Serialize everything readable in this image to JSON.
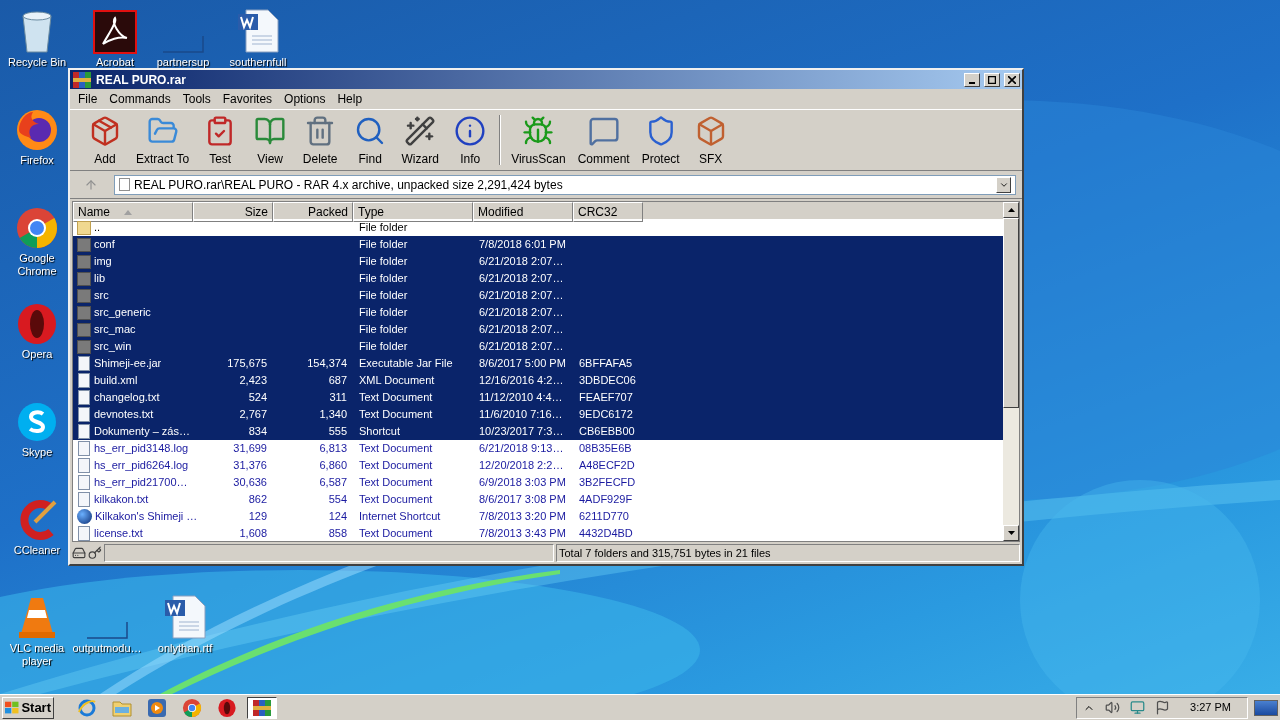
{
  "desktop_icons": [
    {
      "label": "Recycle Bin",
      "kind": "recycle"
    },
    {
      "label": "Acrobat",
      "kind": "acrobat"
    },
    {
      "label": "partnersup",
      "kind": "blank"
    },
    {
      "label": "southernfull",
      "kind": "word"
    },
    {
      "label": "Firefox",
      "kind": "firefox"
    },
    {
      "label": "Google Chrome",
      "kind": "chrome"
    },
    {
      "label": "Opera",
      "kind": "opera"
    },
    {
      "label": "Skype",
      "kind": "skype"
    },
    {
      "label": "CCleaner",
      "kind": "ccleaner"
    },
    {
      "label": "VLC media player",
      "kind": "vlc"
    },
    {
      "label": "outputmodu…",
      "kind": "blank"
    },
    {
      "label": "onlythan.rtf",
      "kind": "word"
    }
  ],
  "window": {
    "title": "REAL PURO.rar",
    "menu": [
      "File",
      "Commands",
      "Tools",
      "Favorites",
      "Options",
      "Help"
    ],
    "toolbar": [
      {
        "label": "Add",
        "kind": "add"
      },
      {
        "label": "Extract To",
        "kind": "extract"
      },
      {
        "label": "Test",
        "kind": "test"
      },
      {
        "label": "View",
        "kind": "view"
      },
      {
        "label": "Delete",
        "kind": "delete"
      },
      {
        "label": "Find",
        "kind": "find"
      },
      {
        "label": "Wizard",
        "kind": "wizard"
      },
      {
        "label": "Info",
        "kind": "info"
      },
      {
        "label": "VirusScan",
        "kind": "virus"
      },
      {
        "label": "Comment",
        "kind": "comment"
      },
      {
        "label": "Protect",
        "kind": "protect"
      },
      {
        "label": "SFX",
        "kind": "sfx"
      }
    ],
    "address": "REAL PURO.rar\\REAL PURO - RAR 4.x archive, unpacked size 2,291,424 bytes",
    "columns": [
      {
        "label": "Name",
        "sorted": true
      },
      {
        "label": "Size",
        "sorted": false
      },
      {
        "label": "Packed",
        "sorted": false
      },
      {
        "label": "Type",
        "sorted": false
      },
      {
        "label": "Modified",
        "sorted": false
      },
      {
        "label": "CRC32",
        "sorted": false
      }
    ],
    "rows": [
      {
        "kind": "parent",
        "name": "..",
        "size": "",
        "packed": "",
        "type": "File folder",
        "modified": "",
        "crc": "",
        "selected": false
      },
      {
        "kind": "folder",
        "name": "conf",
        "size": "",
        "packed": "",
        "type": "File folder",
        "modified": "7/8/2018 6:01 PM",
        "crc": "",
        "selected": true
      },
      {
        "kind": "folder",
        "name": "img",
        "size": "",
        "packed": "",
        "type": "File folder",
        "modified": "6/21/2018 2:07…",
        "crc": "",
        "selected": true
      },
      {
        "kind": "folder",
        "name": "lib",
        "size": "",
        "packed": "",
        "type": "File folder",
        "modified": "6/21/2018 2:07…",
        "crc": "",
        "selected": true
      },
      {
        "kind": "folder",
        "name": "src",
        "size": "",
        "packed": "",
        "type": "File folder",
        "modified": "6/21/2018 2:07…",
        "crc": "",
        "selected": true
      },
      {
        "kind": "folder",
        "name": "src_generic",
        "size": "",
        "packed": "",
        "type": "File folder",
        "modified": "6/21/2018 2:07…",
        "crc": "",
        "selected": true
      },
      {
        "kind": "folder",
        "name": "src_mac",
        "size": "",
        "packed": "",
        "type": "File folder",
        "modified": "6/21/2018 2:07…",
        "crc": "",
        "selected": true
      },
      {
        "kind": "folder",
        "name": "src_win",
        "size": "",
        "packed": "",
        "type": "File folder",
        "modified": "6/21/2018 2:07…",
        "crc": "",
        "selected": true
      },
      {
        "kind": "file",
        "name": "Shimeji-ee.jar",
        "size": "175,675",
        "packed": "154,374",
        "type": "Executable Jar File",
        "modified": "8/6/2017 5:00 PM",
        "crc": "6BFFAFA5",
        "selected": true
      },
      {
        "kind": "file",
        "name": "build.xml",
        "size": "2,423",
        "packed": "687",
        "type": "XML Document",
        "modified": "12/16/2016 4:2…",
        "crc": "3DBDEC06",
        "selected": true
      },
      {
        "kind": "file",
        "name": "changelog.txt",
        "size": "524",
        "packed": "311",
        "type": "Text Document",
        "modified": "11/12/2010 4:4…",
        "crc": "FEAEF707",
        "selected": true
      },
      {
        "kind": "file",
        "name": "devnotes.txt",
        "size": "2,767",
        "packed": "1,340",
        "type": "Text Document",
        "modified": "11/6/2010 7:16…",
        "crc": "9EDC6172",
        "selected": true
      },
      {
        "kind": "file",
        "name": "Dokumenty – zás…",
        "size": "834",
        "packed": "555",
        "type": "Shortcut",
        "modified": "10/23/2017 7:3…",
        "crc": "CB6EBB00",
        "selected": true
      },
      {
        "kind": "file",
        "name": "hs_err_pid3148.log",
        "size": "31,699",
        "packed": "6,813",
        "type": "Text Document",
        "modified": "6/21/2018 9:13…",
        "crc": "08B35E6B",
        "selected": false
      },
      {
        "kind": "file",
        "name": "hs_err_pid6264.log",
        "size": "31,376",
        "packed": "6,860",
        "type": "Text Document",
        "modified": "12/20/2018 2:2…",
        "crc": "A48ECF2D",
        "selected": false
      },
      {
        "kind": "file",
        "name": "hs_err_pid21700…",
        "size": "30,636",
        "packed": "6,587",
        "type": "Text Document",
        "modified": "6/9/2018 3:03 PM",
        "crc": "3B2FECFD",
        "selected": false
      },
      {
        "kind": "file",
        "name": "kilkakon.txt",
        "size": "862",
        "packed": "554",
        "type": "Text Document",
        "modified": "8/6/2017 3:08 PM",
        "crc": "4ADF929F",
        "selected": false
      },
      {
        "kind": "globe",
        "name": "Kilkakon's Shimeji …",
        "size": "129",
        "packed": "124",
        "type": "Internet Shortcut",
        "modified": "7/8/2013 3:20 PM",
        "crc": "6211D770",
        "selected": false
      },
      {
        "kind": "file",
        "name": "license.txt",
        "size": "1,608",
        "packed": "858",
        "type": "Text Document",
        "modified": "7/8/2013 3:43 PM",
        "crc": "4432D4BD",
        "selected": false
      }
    ],
    "status": "Total 7 folders and 315,751 bytes in 21 files"
  },
  "taskbar": {
    "start": "Start",
    "apps": [
      {
        "kind": "ie",
        "selected": false
      },
      {
        "kind": "explorer",
        "selected": false
      },
      {
        "kind": "media",
        "selected": false
      },
      {
        "kind": "chrome",
        "selected": false
      },
      {
        "kind": "opera",
        "selected": false
      },
      {
        "kind": "winrar",
        "selected": true
      }
    ],
    "clock": "3:27 PM"
  }
}
